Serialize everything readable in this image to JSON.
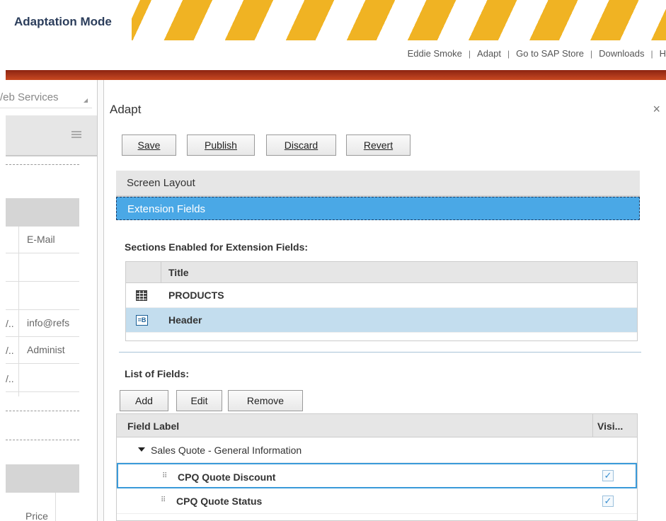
{
  "banner": {
    "title": "Adaptation Mode"
  },
  "toplinks": {
    "user": "Eddie Smoke",
    "adapt": "Adapt",
    "store": "Go to SAP Store",
    "downloads": "Downloads",
    "more": "H",
    "sep": "|"
  },
  "leftpanel": {
    "webservices": "/eb Services",
    "email_header": "E-Mail",
    "email_value": "info@refs",
    "admin_value": "Administ",
    "ellipsis": "/..",
    "price_header": "Price"
  },
  "adapt": {
    "title": "Adapt",
    "close": "×",
    "buttons": {
      "save": "Save",
      "publish": "Publish",
      "discard": "Discard",
      "revert": "Revert"
    },
    "nav": {
      "screen_layout": "Screen Layout",
      "extension_fields": "Extension Fields"
    },
    "sections_label": "Sections Enabled for Extension Fields:",
    "sections_table": {
      "title_header": "Title",
      "rows": [
        {
          "icon": "table-icon",
          "label": "PRODUCTS"
        },
        {
          "icon": "form-icon",
          "label": "Header"
        }
      ]
    },
    "fields_label": "List of Fields:",
    "field_buttons": {
      "add": "Add",
      "edit": "Edit",
      "remove": "Remove"
    },
    "fields_table": {
      "col_label": "Field Label",
      "col_visible": "Visi...",
      "group": "Sales Quote - General Information",
      "rows": [
        {
          "label": "CPQ Quote Discount",
          "visible": true
        },
        {
          "label": "CPQ Quote Status",
          "visible": true
        }
      ]
    }
  },
  "icons": {
    "check": "✓",
    "grip": "⠿",
    "form_icon_text": "=B"
  },
  "colors": {
    "banner_stripe": "#f0b323",
    "selection_blue": "#4aa8e6",
    "row_selected": "#c3ddee",
    "red_bar": "#b03a1c"
  }
}
